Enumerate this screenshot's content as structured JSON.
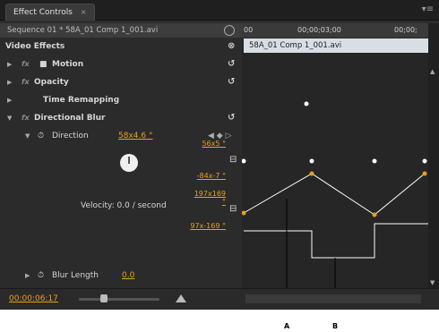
{
  "tab": {
    "label": "Effect Controls",
    "close": "×"
  },
  "panel_menu": "▾≡",
  "sequence": {
    "label": "Sequence 01 * 58A_01 Comp 1_001.avi"
  },
  "ruler": {
    "tick_left": "00",
    "tick_mid": "00;00;03;00",
    "tick_right": "00;00;"
  },
  "clip": {
    "name": "58A_01 Comp 1_001.avi"
  },
  "sections": {
    "video_effects": "Video Effects",
    "motion": "Motion",
    "opacity": "Opacity",
    "time_remapping": "Time Remapping",
    "directional_blur": "Directional Blur",
    "direction_label": "Direction",
    "direction_value": "58x4.6 °",
    "velocity": "Velocity: 0.0 / second",
    "blur_length_label": "Blur Length",
    "blur_length_value": "0.0"
  },
  "graph_labels": {
    "max_val": "56x5 °",
    "min_val": "-84x-7 °",
    "vel_max": "197x169 °",
    "vel_min": "97x-169 °"
  },
  "timecode": "00:00:06:17",
  "callouts": {
    "a": "A",
    "b": "B"
  },
  "colors": {
    "accent": "#e6a020",
    "panel": "#2d2d2d",
    "clip_bar": "#d9dde4"
  }
}
